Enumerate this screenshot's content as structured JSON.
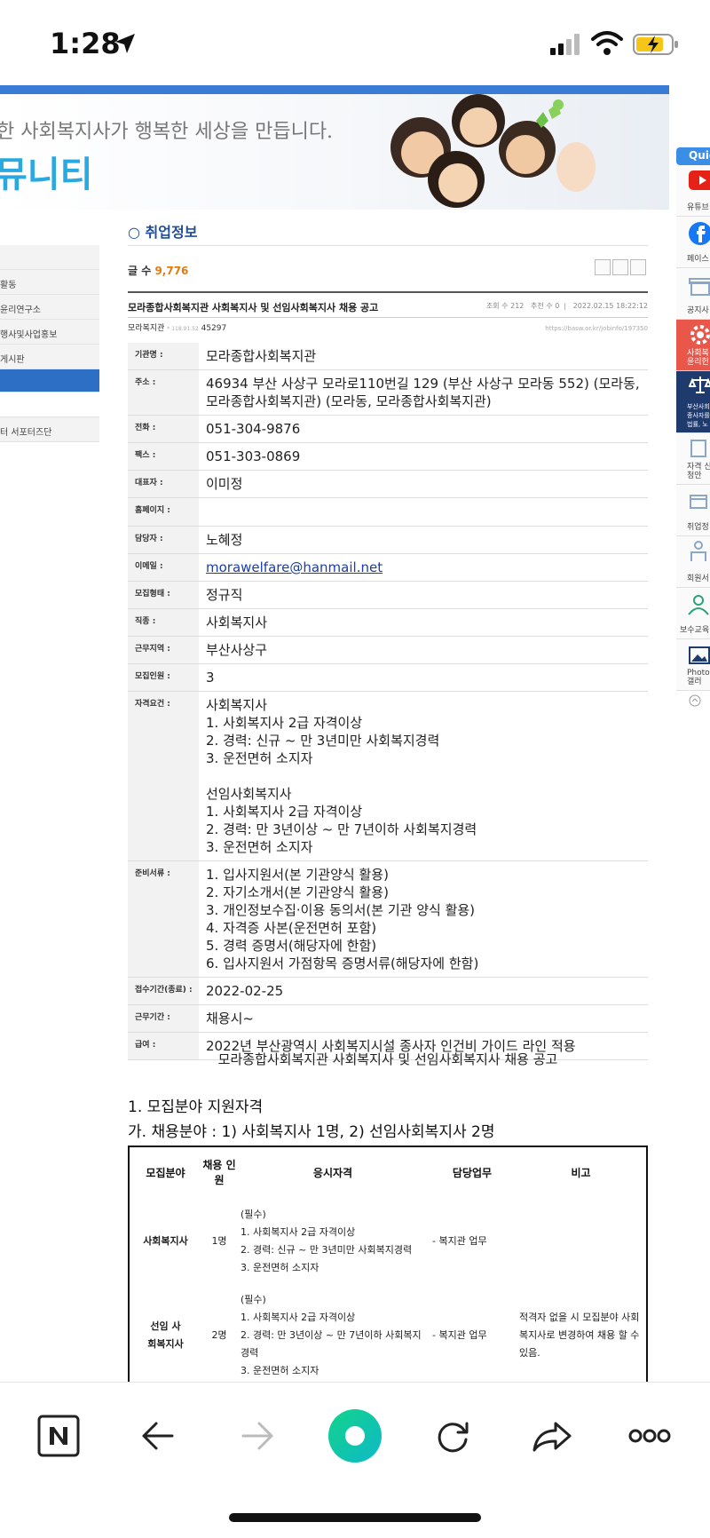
{
  "status": {
    "time": "1:28"
  },
  "banner": {
    "slogan": "한 사회복지사가 행복한 세상을 만듭니다.",
    "title": "뮤니티"
  },
  "leftnav": {
    "items": [
      "활동",
      "윤리연구소",
      "행사및사업홍보",
      "게시판",
      "터 서포터즈단"
    ]
  },
  "quick": {
    "header": "Quic",
    "items": [
      "유튜브 '부사협",
      "페이스",
      "공지사",
      "사회복 윤리헌",
      "부산사회 종사자를 법률, 노",
      "자격 신청안",
      "취업정",
      "회원서",
      "보수교육",
      "Photo 갤러"
    ]
  },
  "board": {
    "section_title": "○ 취업정보",
    "count_label": "글 수",
    "count_value": "9,776",
    "post_title": "모라종합사회복지관 사회복지사 및 선임사회복지사 채용 공고",
    "views_label": "조회 수",
    "views": "212",
    "recommend_label": "추천 수",
    "recommend": "0",
    "date": "2022.02.15 18:22:12",
    "author": "모라복지관",
    "author_ip": "* 118.91.52",
    "post_no": "45297",
    "url": "https://basw.or.kr/jobinfo/197350"
  },
  "info": {
    "rows": [
      {
        "key": "기관명 :",
        "value": "모라종합사회복지관"
      },
      {
        "key": "주소 :",
        "value": "46934 부산 사상구 모라로110번길 129 (부산 사상구 모라동 552) (모라동, 모라종합사회복지관) (모라동, 모라종합사회복지관)"
      },
      {
        "key": "전화 :",
        "value": "051-304-9876"
      },
      {
        "key": "팩스 :",
        "value": "051-303-0869"
      },
      {
        "key": "대표자 :",
        "value": "이미정"
      },
      {
        "key": "홈페이지 :",
        "value": ""
      },
      {
        "key": "담당자 :",
        "value": "노혜정"
      },
      {
        "key": "이메일 :",
        "value": "morawelfare@hanmail.net"
      },
      {
        "key": "모집형태 :",
        "value": "정규직"
      },
      {
        "key": "직종 :",
        "value": "사회복지사"
      },
      {
        "key": "근무지역 :",
        "value": "부산사상구"
      },
      {
        "key": "모집인원 :",
        "value": "3"
      }
    ],
    "qualification_key": "자격요건 :",
    "qualification_lines": [
      "사회복지사",
      "1. 사회복지사 2급 자격이상",
      "2. 경력: 신규 ~ 만 3년미만 사회복지경력",
      "3. 운전면허 소지자",
      "",
      "선임사회복지사",
      "1. 사회복지사 2급 자격이상",
      "2. 경력: 만 3년이상 ~ 만 7년이하 사회복지경력",
      "3. 운전면허 소지자"
    ],
    "documents_key": "준비서류 :",
    "documents_lines": [
      "1. 입사지원서(본 기관양식 활용)",
      "2. 자기소개서(본 기관양식 활용)",
      "3. 개인정보수집·이용 동의서(본 기관 양식 활용)",
      "4. 자격증 사본(운전면허 포함)",
      "5. 경력 증명서(해당자에 한함)",
      "6. 입사지원서 가점항목 증명서류(해당자에 한함)"
    ],
    "deadline_key": "접수기간(종료) :",
    "deadline": "2022-02-25",
    "period_key": "근무기간 :",
    "period": "채용시~",
    "salary_key": "급여 :",
    "salary": "2022년 부산광역시 사회복지시설 종사자 인건비 가이드 라인 적용"
  },
  "notice": {
    "title": "모라종합사회복지관 사회복지사 및 선임사회복지사 채용 공고",
    "heading1": "1. 모집분야 지원자격",
    "heading2": "가. 채용분야 : 1) 사회복지사 1명, 2) 선임사회복지사 2명",
    "table": {
      "headers": [
        "모집분야",
        "채용 인원",
        "응시자격",
        "담당업무",
        "비고"
      ],
      "rows": [
        {
          "field": "사회복지사",
          "count": "1명",
          "qual": [
            "(필수)",
            "1. 사회복지사 2급 자격이상",
            "2. 경력: 신규 ~ 만 3년미만 사회복지경력",
            "3. 운전면허 소지자"
          ],
          "duty": "- 복지관 업무",
          "note": ""
        },
        {
          "field": "선임 사회복지사",
          "count": "2명",
          "qual": [
            "(필수)",
            "1. 사회복지사 2급 자격이상",
            "2. 경력: 만 3년이상 ~ 만 7년이하 사회복지경력",
            "3. 운전면허 소지자"
          ],
          "duty": "- 복지관 업무",
          "note": "적격자 없을 시 모집분야 사회복지사로 변경하여 채용 할 수 있음."
        }
      ]
    }
  },
  "toolbar": {
    "icons": [
      "naver-n-icon",
      "back-arrow-icon",
      "forward-arrow-icon",
      "green-circle-icon",
      "reload-icon",
      "share-icon",
      "more-icon"
    ]
  }
}
